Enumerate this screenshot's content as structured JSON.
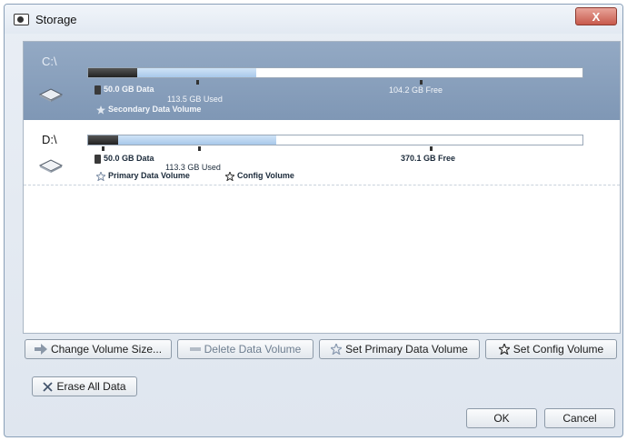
{
  "window": {
    "title": "Storage",
    "close_label": "X"
  },
  "volumes": [
    {
      "drive": "C:\\",
      "data_label": "50.0 GB Data",
      "used_label": "113.5 GB Used",
      "free_label": "104.2 GB Free",
      "tags": [
        "Secondary Data Volume"
      ],
      "selected": true,
      "data_fraction": 0.1,
      "used_fraction": 0.34
    },
    {
      "drive": "D:\\",
      "data_label": "50.0 GB Data",
      "used_label": "113.3 GB Used",
      "free_label": "370.1 GB Free",
      "tags": [
        "Primary Data Volume",
        "Config Volume"
      ],
      "selected": false,
      "data_fraction": 0.06,
      "used_fraction": 0.38
    }
  ],
  "buttons": {
    "change_volume_size": "Change Volume Size...",
    "delete_data_volume": "Delete Data Volume",
    "set_primary_data_volume": "Set Primary Data Volume",
    "set_config_volume": "Set Config Volume",
    "erase_all_data": "Erase All Data",
    "ok": "OK",
    "cancel": "Cancel"
  },
  "colors": {
    "selection": "#8aa2c0",
    "data_segment": "#333333",
    "used_segment": "#b9d4ef"
  }
}
